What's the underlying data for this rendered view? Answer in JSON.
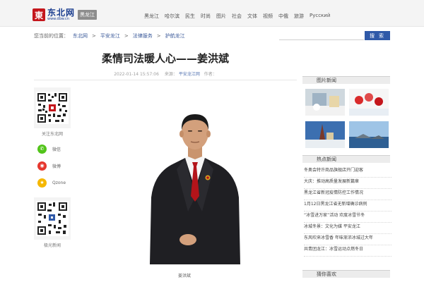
{
  "site": {
    "logo_mark": "東",
    "logo_name": "东北网",
    "logo_url": "www.dbw.cn",
    "region": "黑龙江"
  },
  "nav": [
    "黑龙江",
    "哈尔滨",
    "民生",
    "时尚",
    "图片",
    "社会",
    "文体",
    "视频",
    "中俄",
    "旅游",
    "Русский"
  ],
  "breadcrumb": {
    "prefix": "您当前的位置：",
    "items": [
      "东北网",
      "平安龙江",
      "法律服务",
      "护航龙江"
    ],
    "separator": ">"
  },
  "search": {
    "button_label": "搜 索",
    "placeholder": ""
  },
  "article": {
    "title": "柔情司法暖人心——姜洪斌",
    "datetime": "2022-01-14 15:57:06",
    "source_label": "来源：",
    "source": "平安龙江网",
    "author_label": "作者："
  },
  "left_col": {
    "follow_label": "关注东北网",
    "share": [
      {
        "label": "微信",
        "icon": "wechat-icon",
        "color": "#52c41a",
        "glyph": "✆"
      },
      {
        "label": "微博",
        "icon": "weibo-icon",
        "color": "#e6372e",
        "glyph": "◉"
      },
      {
        "label": "Qzone",
        "icon": "qzone-icon",
        "color": "#f5b700",
        "glyph": "★"
      }
    ],
    "app_label": "极光新闻"
  },
  "photo_caption": "姜洪斌",
  "sidebar": {
    "pictures_title": "图片新闻",
    "hot_title": "热点新闻",
    "more_title": "猜你喜欢",
    "hot_news": [
      "冬奥会特许商品旗舰店开门迎客",
      "大庆：推动高质量发展新篇章",
      "黑龙江省新冠疫情防控工作情况",
      "1月12日黑龙江省无新增确诊病例",
      "“冰雪进万家”活动 欢度冰雪节冬",
      "冰城冬景：文化为媒 平安龙江",
      "东风吹来冰雪香 年味渐浓冰城过大年",
      "共青团龙江：冰雪运动点燃冬日"
    ]
  }
}
